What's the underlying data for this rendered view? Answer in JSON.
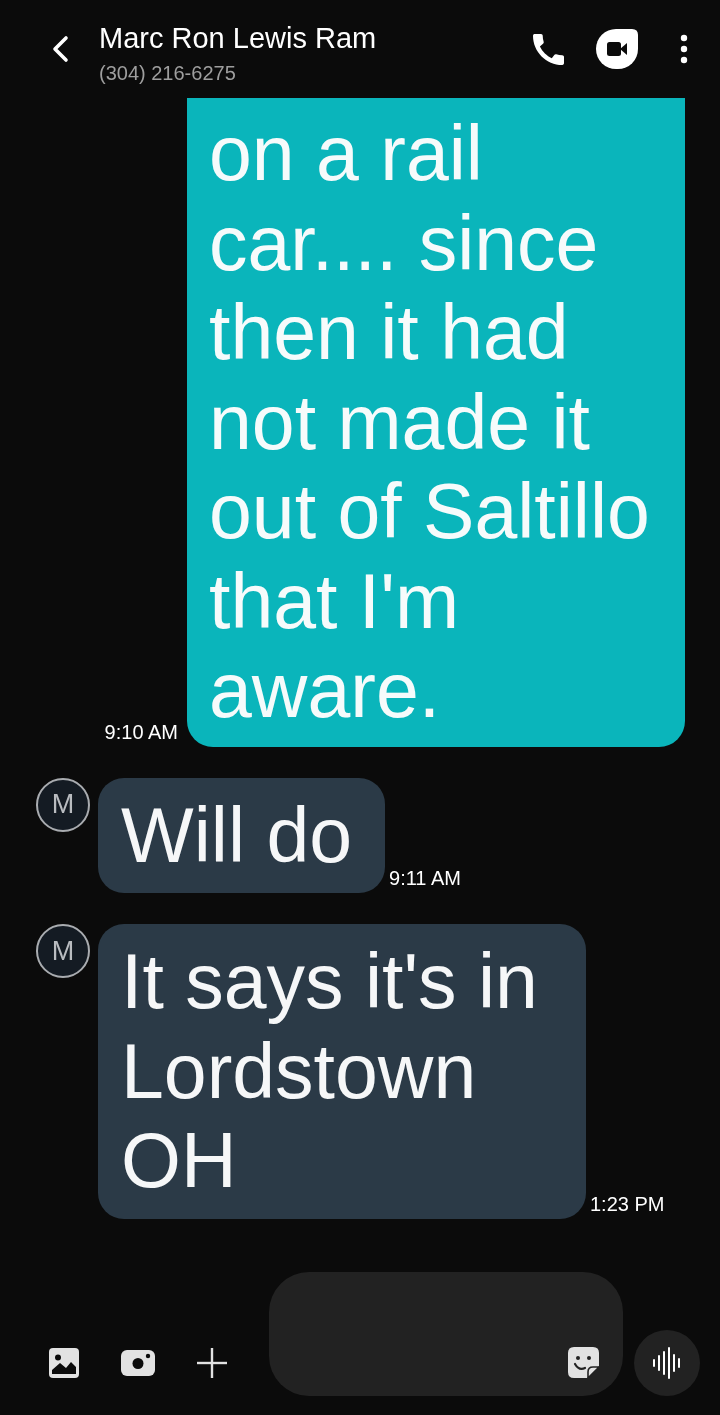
{
  "header": {
    "contact_name": "Marc Ron Lewis Ram",
    "phone_number": "(304) 216-6275"
  },
  "messages": [
    {
      "kind": "outgoing",
      "cut_off_top": true,
      "text": "on a rail car.... since then it had not made it out of Saltillo that I'm aware.",
      "time": "9:10 AM"
    },
    {
      "kind": "incoming",
      "cut_off_top": false,
      "avatar_letter": "M",
      "text": "Will do",
      "time": "9:11 AM"
    },
    {
      "kind": "incoming",
      "cut_off_top": false,
      "avatar_letter": "M",
      "text": "It says it's in Lordstown OH",
      "time": "1:23 PM"
    }
  ]
}
